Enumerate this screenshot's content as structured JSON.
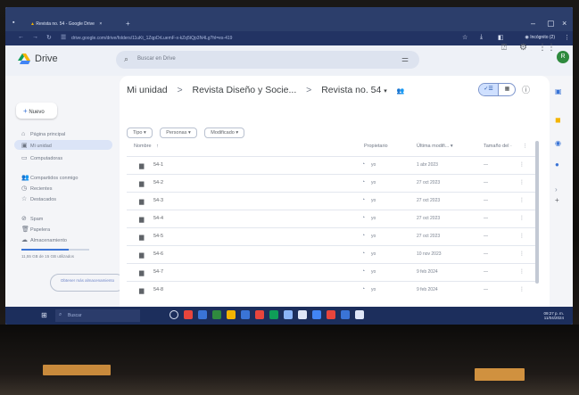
{
  "browser": {
    "tab_title": "Revista no. 54 - Google Drive",
    "tab_close": "×",
    "new_tab": "+",
    "url": "drive.google.com/drive/folders/11uKt_1ZqpDrLuemF-x-kZq5tQp3N4Lg?hl=es-419",
    "profile_label": "Incógnito (2)",
    "minimize": "–",
    "maximize": "▢",
    "close": "×"
  },
  "drive": {
    "logo_text": "Drive",
    "search_placeholder": "Buscar en Drive"
  },
  "sidebar": {
    "new_label": "Nuevo",
    "items": [
      {
        "icon": "⌂",
        "label": "Página principal"
      },
      {
        "icon": "▣",
        "label": "Mi unidad"
      },
      {
        "icon": "▭",
        "label": "Computadoras"
      },
      {
        "icon": "👥",
        "label": "Compartidos conmigo"
      },
      {
        "icon": "◷",
        "label": "Recientes"
      },
      {
        "icon": "☆",
        "label": "Destacados"
      },
      {
        "icon": "⊘",
        "label": "Spam"
      },
      {
        "icon": "🗑",
        "label": "Papelera"
      },
      {
        "icon": "☁",
        "label": "Almacenamiento"
      }
    ],
    "storage_fraction": 0.7,
    "storage_text": "11,55 GB de 15 GB utilizados",
    "buy_label": "Obtener más almacenamiento"
  },
  "main": {
    "breadcrumb": [
      "Mi unidad",
      "Revista Diseño y Socie...",
      "Revista no. 54"
    ],
    "breadcrumb_sep": ">",
    "breadcrumb_caret": "▾",
    "filters": [
      "Tipo",
      "Personas",
      "Modificado"
    ],
    "chip_caret": "▾",
    "columns": {
      "name": "Nombre",
      "name_sort": "↑",
      "owner": "Propietario",
      "modified": "Última modifi...",
      "modified_caret": "▾",
      "size": "Tamaño del ·",
      "more": "⋮"
    },
    "rows": [
      {
        "name": "54-1",
        "owner": "yo",
        "modified": "1 abr 2023",
        "size": "—"
      },
      {
        "name": "54-2",
        "owner": "yo",
        "modified": "27 oct 2023",
        "size": "—"
      },
      {
        "name": "54-3",
        "owner": "yo",
        "modified": "27 oct 2023",
        "size": "—"
      },
      {
        "name": "54-4",
        "owner": "yo",
        "modified": "27 oct 2023",
        "size": "—"
      },
      {
        "name": "54-5",
        "owner": "yo",
        "modified": "27 oct 2023",
        "size": "—"
      },
      {
        "name": "54-6",
        "owner": "yo",
        "modified": "10 nov 2023",
        "size": "—"
      },
      {
        "name": "54-7",
        "owner": "yo",
        "modified": "9 feb 2024",
        "size": "—"
      },
      {
        "name": "54-8",
        "owner": "yo",
        "modified": "9 feb 2024",
        "size": "—"
      }
    ]
  },
  "taskbar": {
    "search_placeholder": "Buscar",
    "time": "09:27 p. m.",
    "date": "11/04/2024"
  },
  "colors": {
    "accent": "#3a74d6",
    "avatar": "#2f8a3e",
    "taskbar": "#1c2e5c"
  }
}
